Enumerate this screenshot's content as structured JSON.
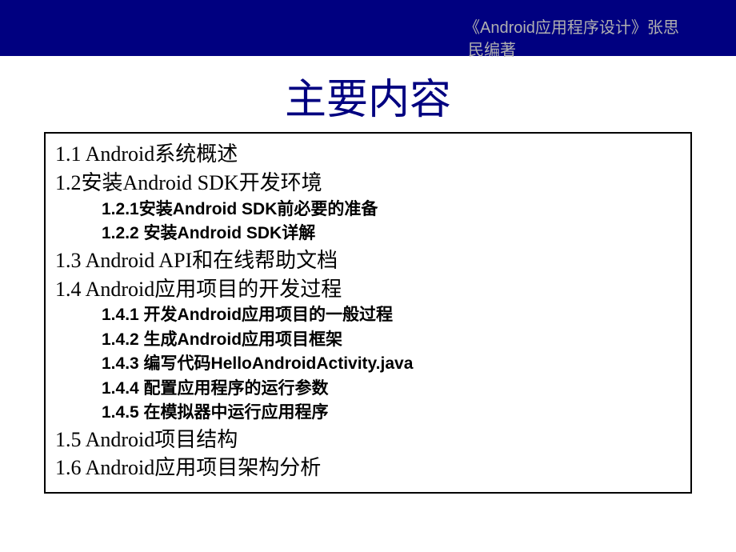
{
  "header": {
    "line1": "《Android应用程序设计》张思",
    "line2": "民编著"
  },
  "title": "主要内容",
  "toc": {
    "s1": "1.1 Android系统概述",
    "s2": "1.2安装Android SDK开发环境",
    "s2_1": "1.2.1安装Android SDK前必要的准备",
    "s2_2": "1.2.2   安装Android SDK详解",
    "s3": "1.3 Android API和在线帮助文档",
    "s4": "1.4 Android应用项目的开发过程",
    "s4_1": "1.4.1 开发Android应用项目的一般过程",
    "s4_2": "1.4.2 生成Android应用项目框架",
    "s4_3": "1.4.3 编写代码HelloAndroidActivity.java",
    "s4_4": "1.4.4 配置应用程序的运行参数",
    "s4_5": "1.4.5 在模拟器中运行应用程序",
    "s5": "1.5 Android项目结构",
    "s6": "1.6 Android应用项目架构分析"
  }
}
